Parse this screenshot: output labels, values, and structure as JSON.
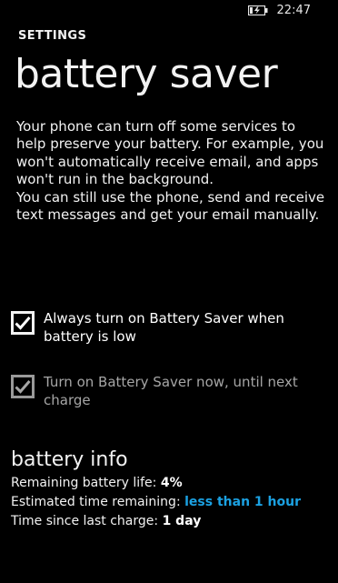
{
  "status": {
    "time": "22:47",
    "battery_icon": "battery-charging-icon"
  },
  "header": {
    "kicker": "SETTINGS",
    "title": "battery saver"
  },
  "description": {
    "para1": "Your phone can turn off some services to help preserve your battery. For example, you won't automatically receive email, and apps won't run in the background.",
    "para2": "You can still use the phone, send and receive text messages and get your email manually."
  },
  "options": [
    {
      "label": "Always turn on Battery Saver when battery is low",
      "checked": true
    },
    {
      "label": "Turn on Battery Saver now, until next charge",
      "checked": true,
      "dimmed": true
    }
  ],
  "battery_info": {
    "title": "battery info",
    "rows": [
      {
        "label": "Remaining battery life:",
        "value": "4%"
      },
      {
        "label": "Estimated time remaining:",
        "value": "less than 1 hour"
      },
      {
        "label": "Time since last charge:",
        "value": "1 day"
      }
    ]
  },
  "colors": {
    "background": "#000000",
    "text": "#f2f2f2",
    "accent": "#1ba1e2",
    "disabled": "#a6a6a6"
  }
}
